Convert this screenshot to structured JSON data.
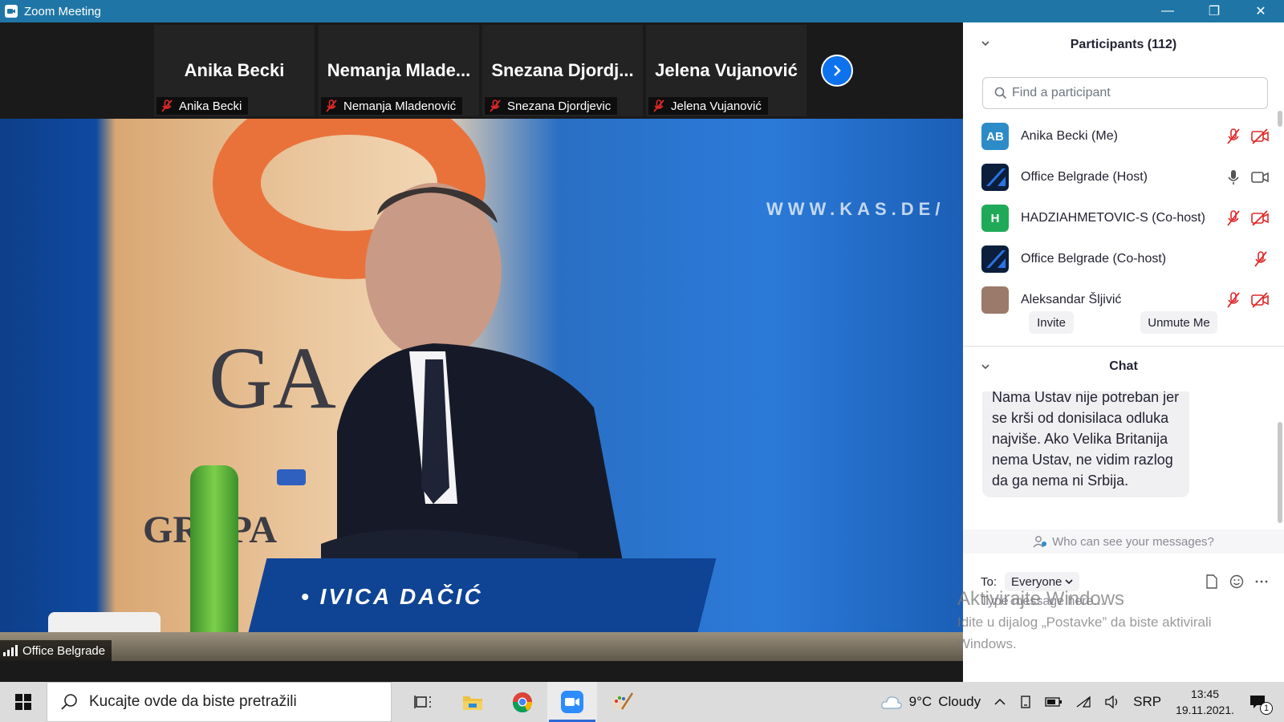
{
  "window": {
    "title": "Zoom Meeting",
    "minimize": "—",
    "restore": "❐",
    "close": "✕"
  },
  "gallery": {
    "tiles": [
      {
        "big_name": "Anika Becki",
        "tag": "Anika Becki"
      },
      {
        "big_name": "Nemanja  Mlade...",
        "tag": "Nemanja Mladenović"
      },
      {
        "big_name": "Snezana  Djordj...",
        "tag": "Snezana Djordjevic"
      },
      {
        "big_name": "Jelena Vujanović",
        "tag": "Jelena Vujanović"
      }
    ],
    "next_icon": "chevron-right-icon"
  },
  "video": {
    "speaker_label": "Office Belgrade",
    "nameplate": "• IVICA DAČIĆ",
    "banner_url": "WWW.KAS.DE/",
    "logo_letters": "GA",
    "banner_word": "GRUPA"
  },
  "participants": {
    "header": "Participants (112)",
    "search_placeholder": "Find a participant",
    "list": [
      {
        "initials": "AB",
        "name": "Anika Becki (Me)",
        "avatar_color": "#2d8cc7",
        "mic": "muted",
        "video": "off"
      },
      {
        "initials": "",
        "name": "Office Belgrade (Host)",
        "avatar_color": "#0b1e3c",
        "mic": "on",
        "video": "on"
      },
      {
        "initials": "H",
        "name": "HADZIAHMETOVIC-S (Co-host)",
        "avatar_color": "#1faa5a",
        "mic": "muted",
        "video": "off"
      },
      {
        "initials": "",
        "name": "Office Belgrade (Co-host)",
        "avatar_color": "#0b1e3c",
        "mic": "muted",
        "video": "none"
      },
      {
        "initials": "",
        "name": "Aleksandar Šljivić",
        "avatar_color": "#9a7a6a",
        "mic": "muted",
        "video": "off"
      }
    ],
    "invite_label": "Invite",
    "unmute_label": "Unmute Me"
  },
  "chat": {
    "header": "Chat",
    "message": "Nama Ustav nije potreban jer se krši od donisilaca odluka najviše. Ako Velika Britanija nema Ustav, ne vidim razlog da ga nema ni Srbija.",
    "who_can_see": "Who can see your messages?",
    "to_label": "To:",
    "to_value": "Everyone",
    "placeholder": "Type message here..."
  },
  "watermark": {
    "line1": "Aktivirajte Windows",
    "line2": "Idite u dijalog „Postavke” da biste aktivirali",
    "line3": "Windows."
  },
  "taskbar": {
    "search_text": "Kucajte ovde da biste pretražili",
    "weather_temp": "9°C",
    "weather_desc": "Cloudy",
    "language": "SRP",
    "time": "13:45",
    "date": "19.11.2021.",
    "notification_count": "1"
  },
  "colors": {
    "titlebar": "#1f76a6",
    "accent_blue": "#0e72ed",
    "muted_red": "#e02828"
  }
}
